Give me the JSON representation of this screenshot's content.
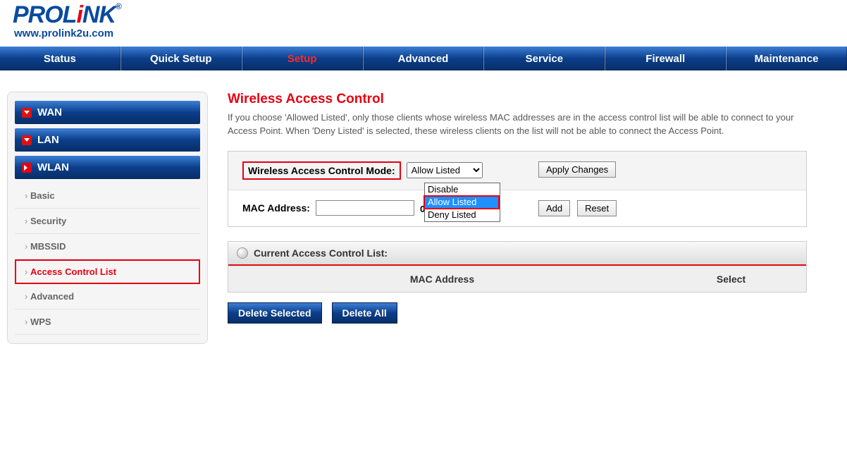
{
  "brand": {
    "name": "PROLiNK",
    "url": "www.prolink2u.com"
  },
  "topnav": {
    "status": "Status",
    "quick_setup": "Quick Setup",
    "setup": "Setup",
    "advanced": "Advanced",
    "service": "Service",
    "firewall": "Firewall",
    "maintenance": "Maintenance"
  },
  "sidebar": {
    "wan": "WAN",
    "lan": "LAN",
    "wlan": "WLAN",
    "sub": {
      "basic": "Basic",
      "security": "Security",
      "mbssid": "MBSSID",
      "acl": "Access Control List",
      "advanced": "Advanced",
      "wps": "WPS"
    }
  },
  "page": {
    "title": "Wireless Access Control",
    "desc": "If you choose 'Allowed Listed', only those clients whose wireless MAC addresses are in the access control list will be able to connect to your Access Point. When 'Deny Listed' is selected, these wireless clients on the list will not be able to connect the Access Point."
  },
  "form": {
    "mode_label": "Wireless Access Control Mode:",
    "mode_selected": "Allow Listed",
    "mode_options": {
      "disable": "Disable",
      "allow": "Allow Listed",
      "deny": "Deny Listed"
    },
    "apply_changes": "Apply Changes",
    "mac_label": "MAC Address:",
    "mac_value": "",
    "mac_note": "00E086710502)",
    "add": "Add",
    "reset": "Reset"
  },
  "list": {
    "header": "Current Access Control List:",
    "col_mac": "MAC Address",
    "col_select": "Select"
  },
  "actions": {
    "delete_selected": "Delete Selected",
    "delete_all": "Delete All"
  }
}
